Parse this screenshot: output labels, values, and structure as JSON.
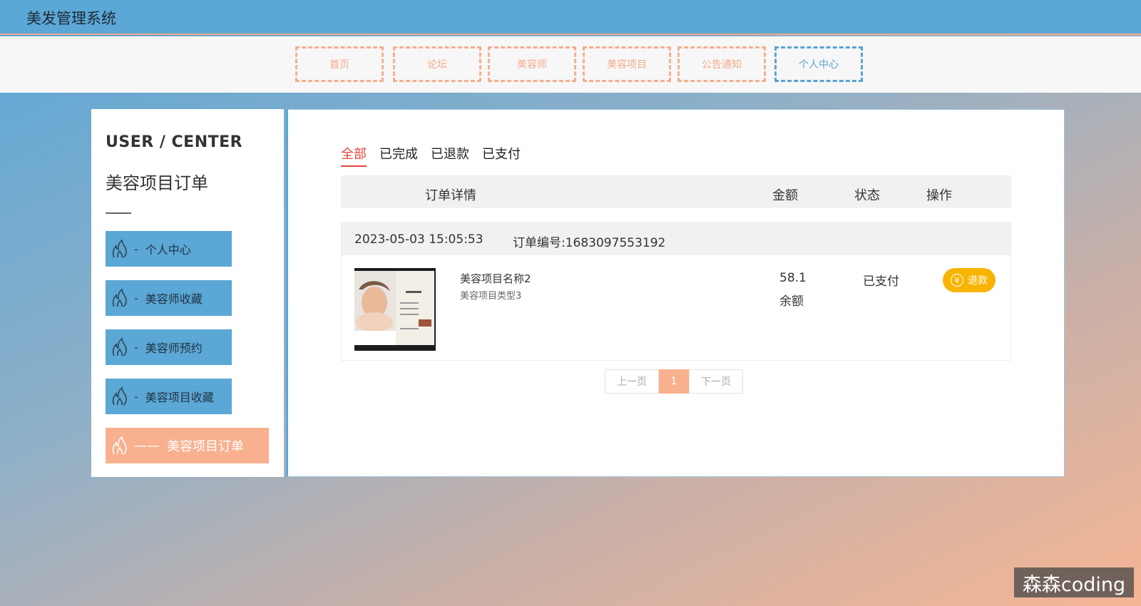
{
  "app": {
    "title": "美发管理系统"
  },
  "nav": {
    "items": [
      {
        "label": "首页"
      },
      {
        "label": "论坛"
      },
      {
        "label": "美容师"
      },
      {
        "label": "美容项目"
      },
      {
        "label": "公告通知"
      },
      {
        "label": "个人中心",
        "active": true
      }
    ],
    "colors": {
      "inactive": "#f4b08f",
      "active": "#5aa3d0"
    }
  },
  "sidebar": {
    "title": "USER / CENTER",
    "subtitle": "美容项目订单",
    "items": [
      {
        "label": "个人中心",
        "icon": "flame-icon"
      },
      {
        "label": "美容师收藏",
        "icon": "flame-icon"
      },
      {
        "label": "美容师预约",
        "icon": "flame-icon"
      },
      {
        "label": "美容项目收藏",
        "icon": "flame-icon"
      },
      {
        "label": "美容项目订单",
        "icon": "flame-icon",
        "active": true
      }
    ],
    "dash": "-",
    "active_dash": "——"
  },
  "orders": {
    "tabs": [
      {
        "label": "全部",
        "active": true
      },
      {
        "label": "已完成"
      },
      {
        "label": "已退款"
      },
      {
        "label": "已支付"
      }
    ],
    "columns": [
      "订单详情",
      "金额",
      "状态",
      "操作"
    ],
    "list": [
      {
        "date": "2023-05-03 15:05:53",
        "order_no": "订单编号:1683097553192",
        "name": "美容项目名称2",
        "type": "美容项目类型3",
        "price": "58.1",
        "pay_method": "余额",
        "status": "已支付",
        "action": "退款",
        "action_icon": "yen-icon"
      }
    ]
  },
  "pager": {
    "prev": "上一页",
    "current": "1",
    "next": "下一页"
  },
  "watermark": "森森coding",
  "colors": {
    "header": "#5ba7d6",
    "accent": "#f8b08f",
    "refund": "#f8b400",
    "tab_active": "#e4473b"
  }
}
